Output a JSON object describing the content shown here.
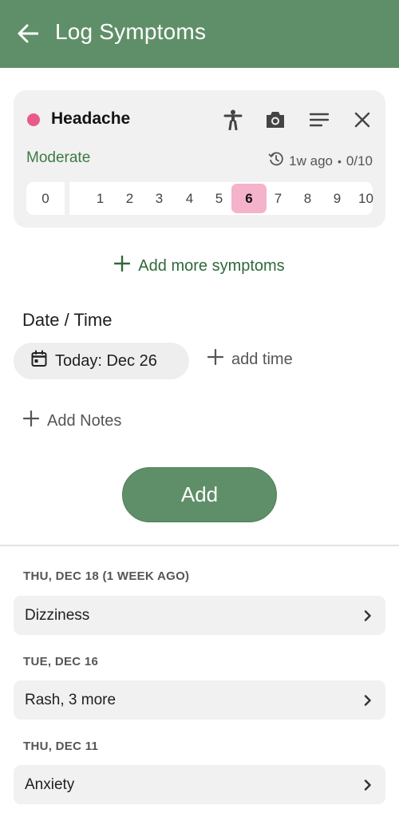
{
  "header": {
    "title": "Log Symptoms"
  },
  "symptom": {
    "name": "Headache",
    "color": "#e85a8c",
    "severity_label": "Moderate",
    "last_logged": "1w ago",
    "separator": "•",
    "max_label": "0/10",
    "scale": [
      "0",
      "1",
      "2",
      "3",
      "4",
      "5",
      "6",
      "7",
      "8",
      "9",
      "10"
    ],
    "selected": 6,
    "tools": [
      "body-map-icon",
      "camera-icon",
      "notes-icon",
      "close-icon"
    ]
  },
  "add_more_label": "Add more symptoms",
  "datetime": {
    "label": "Date / Time",
    "date_chip": "Today: Dec 26",
    "add_time": "add time"
  },
  "add_notes_label": "Add Notes",
  "submit_label": "Add",
  "history": [
    {
      "date": "THU, DEC 18 (1 WEEK AGO)",
      "summary": "Dizziness"
    },
    {
      "date": "TUE, DEC 16",
      "summary": "Rash, 3 more"
    },
    {
      "date": "THU, DEC 11",
      "summary": "Anxiety"
    }
  ],
  "colors": {
    "primary": "#5f8f68",
    "accent_text": "#2f6a39",
    "selected_scale": "#f5b3cb",
    "card_bg": "#f1f1f1"
  }
}
